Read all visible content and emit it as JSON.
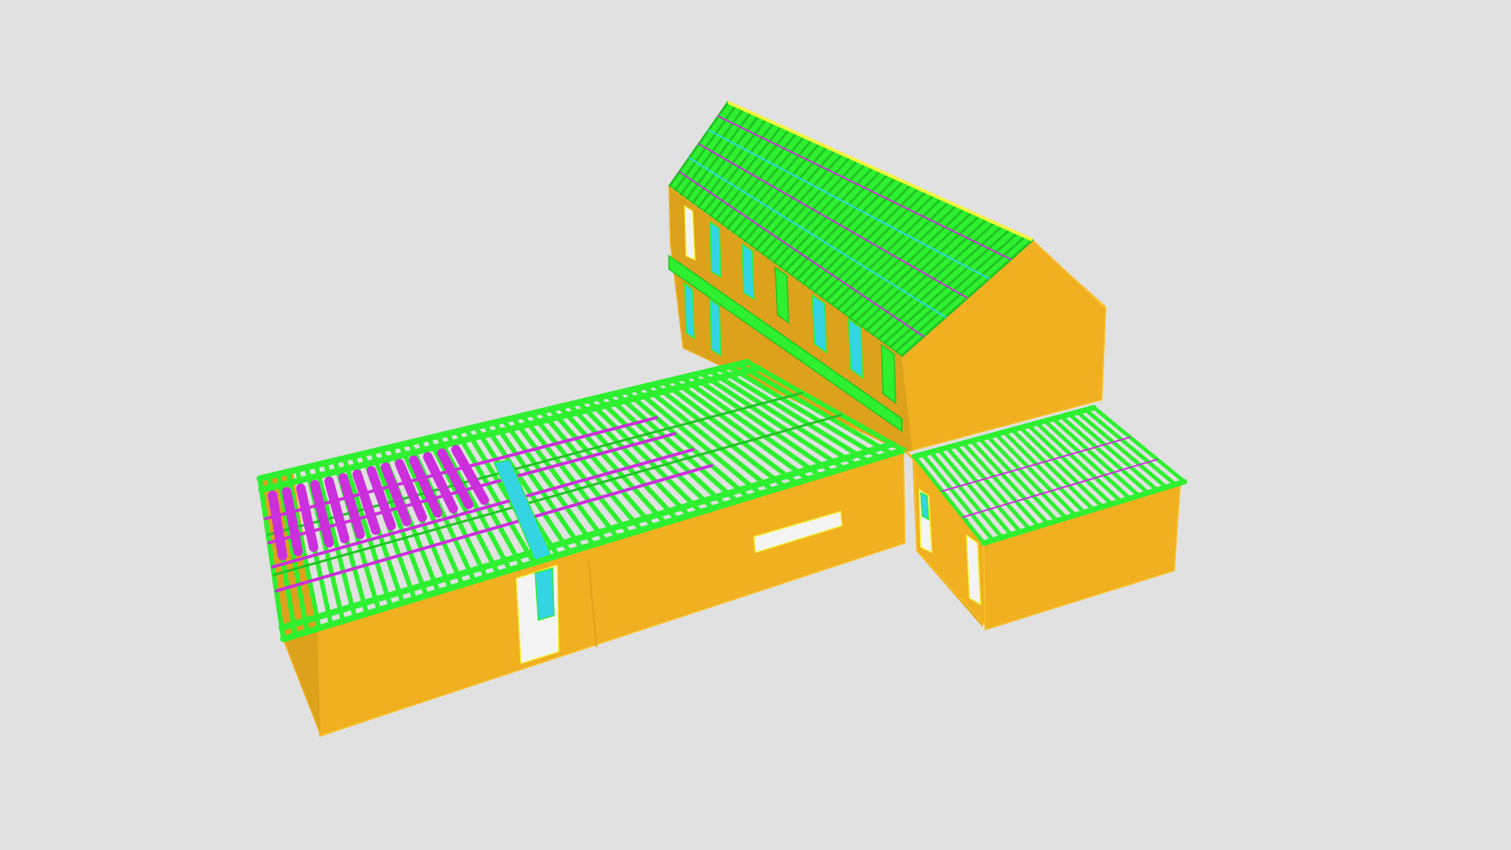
{
  "viewer": {
    "background_color": "#e1e1e1"
  },
  "model": {
    "colors": {
      "wall": "#f0b020",
      "wall_shade": "#dca21c",
      "wall_highlight": "#f7c22c",
      "timber": "#2ef030",
      "timber_dark": "#21c324",
      "member_magenta": "#cc2fdc",
      "glass_cyan": "#33d5e2",
      "edge_yellow": "#f3f53a",
      "opening_white": "#f4f4f4"
    }
  }
}
